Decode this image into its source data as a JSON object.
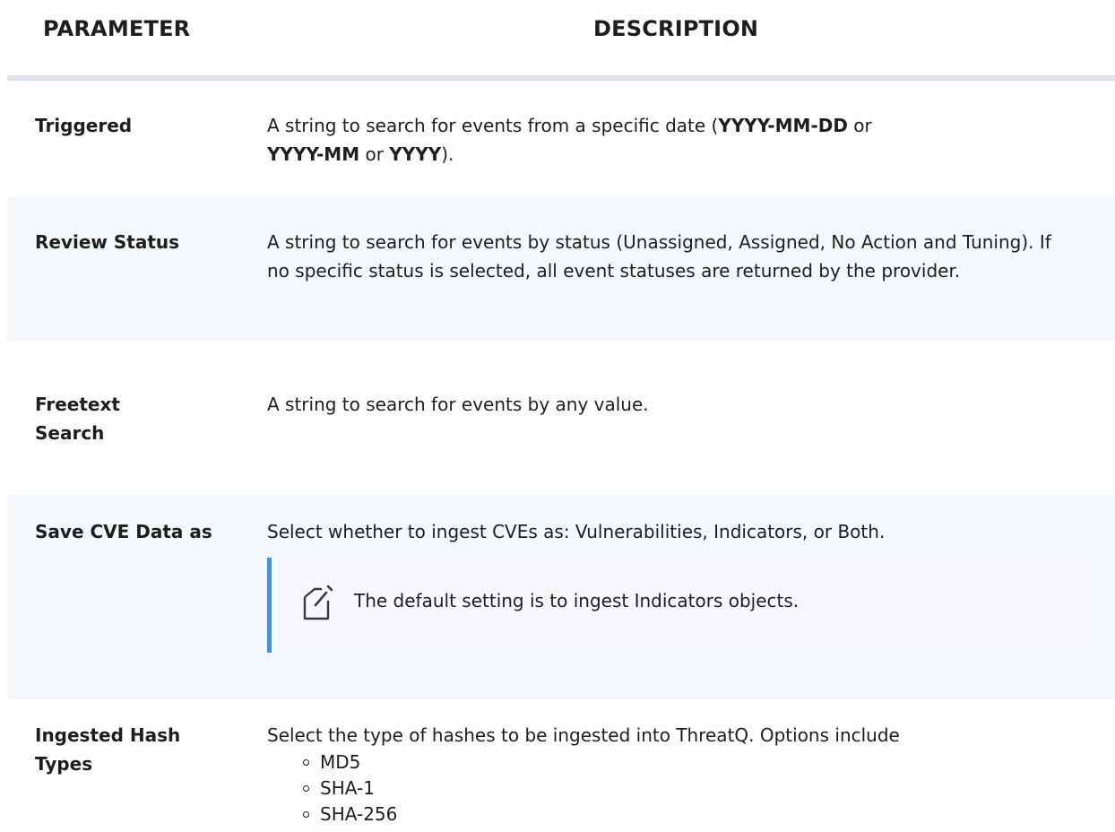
{
  "header": {
    "parameter": "PARAMETER",
    "description": "DESCRIPTION"
  },
  "rows": [
    {
      "param": "Triggered",
      "desc": {
        "t1": "A string to search for events from a specific date (",
        "b1": "YYYY-MM-DD",
        "t2": " or",
        "b2": "YYYY-MM",
        "t3": " or ",
        "b3": "YYYY",
        "t4": ")."
      }
    },
    {
      "param": "Review Status",
      "desc": "A string to search for events by status (Unassigned, Assigned, No Action and Tuning). If no specific status is selected, all event statuses are returned by the provider."
    },
    {
      "param": "Freetext Search",
      "desc": "A string to search for events by any value."
    },
    {
      "param": "Save CVE Data as",
      "desc": "Select whether to ingest CVEs as: Vulnerabilities,  Indicators, or Both.",
      "note": "The default setting is to ingest Indicators objects.",
      "note_icon": "note-edit-icon"
    },
    {
      "param": "Ingested Hash Types",
      "desc": "Select the type of hashes to be ingested into ThreatQ.  Options include",
      "options": [
        "MD5",
        "SHA-1",
        "SHA-256"
      ]
    }
  ],
  "colors": {
    "text": "#1e1e1e",
    "alt_row": "#f4f7fb",
    "header_rule": "#dfe3ea",
    "note_accent": "#4a90d6"
  }
}
